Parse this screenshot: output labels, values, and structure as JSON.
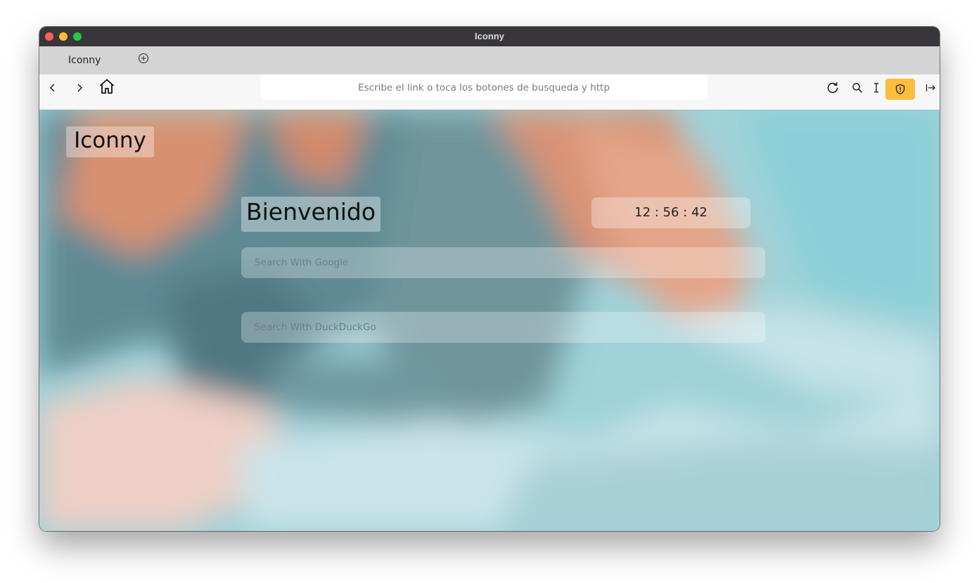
{
  "window": {
    "title": "Iconny"
  },
  "tabs": [
    {
      "label": "Iconny"
    }
  ],
  "toolbar": {
    "url_placeholder": "Escribe el link o toca los botones de busqueda y http",
    "icons": [
      "back-icon",
      "forward-icon",
      "home-icon",
      "reload-icon",
      "search-icon",
      "text-cursor-icon",
      "shield-icon",
      "exit-icon"
    ],
    "accent_color": "#fdbd3d"
  },
  "page": {
    "logo": "Iconny",
    "greeting": "Bienvenido",
    "clock": "12 : 56 : 42",
    "search_google_placeholder": "Search With Google",
    "search_duckduckgo_placeholder": "Search With DuckDuckGo"
  }
}
